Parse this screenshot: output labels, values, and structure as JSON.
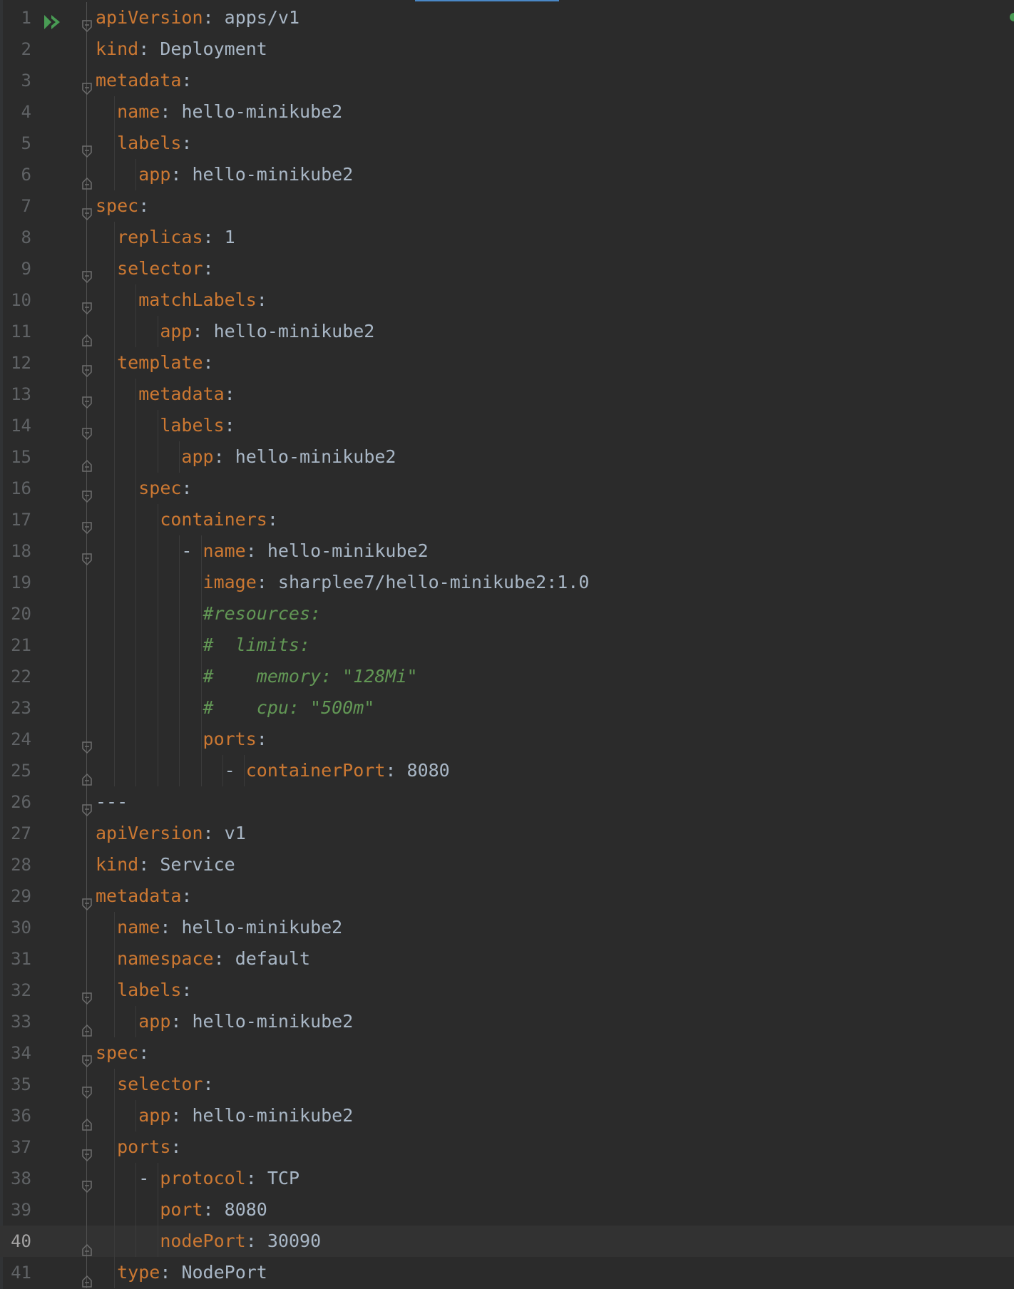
{
  "editor": {
    "language": "yaml",
    "current_line": 40,
    "colors": {
      "background": "#2b2b2b",
      "key": "#cc7832",
      "value": "#a9b7c6",
      "comment": "#629755",
      "line_number": "#606366",
      "current_line_bg": "#323232"
    },
    "lines": [
      {
        "n": "1",
        "indent": "",
        "key": "apiVersion",
        "value": "apps/v1"
      },
      {
        "n": "2",
        "indent": "",
        "key": "kind",
        "value": "Deployment"
      },
      {
        "n": "3",
        "indent": "",
        "key": "metadata",
        "value": ""
      },
      {
        "n": "4",
        "indent": "  ",
        "key": "name",
        "value": "hello-minikube2"
      },
      {
        "n": "5",
        "indent": "  ",
        "key": "labels",
        "value": ""
      },
      {
        "n": "6",
        "indent": "    ",
        "key": "app",
        "value": "hello-minikube2"
      },
      {
        "n": "7",
        "indent": "",
        "key": "spec",
        "value": ""
      },
      {
        "n": "8",
        "indent": "  ",
        "key": "replicas",
        "value": "1"
      },
      {
        "n": "9",
        "indent": "  ",
        "key": "selector",
        "value": ""
      },
      {
        "n": "10",
        "indent": "    ",
        "key": "matchLabels",
        "value": ""
      },
      {
        "n": "11",
        "indent": "      ",
        "key": "app",
        "value": "hello-minikube2"
      },
      {
        "n": "12",
        "indent": "  ",
        "key": "template",
        "value": ""
      },
      {
        "n": "13",
        "indent": "    ",
        "key": "metadata",
        "value": ""
      },
      {
        "n": "14",
        "indent": "      ",
        "key": "labels",
        "value": ""
      },
      {
        "n": "15",
        "indent": "        ",
        "key": "app",
        "value": "hello-minikube2"
      },
      {
        "n": "16",
        "indent": "    ",
        "key": "spec",
        "value": ""
      },
      {
        "n": "17",
        "indent": "      ",
        "key": "containers",
        "value": ""
      },
      {
        "n": "18",
        "indent": "        - ",
        "key": "name",
        "value": "hello-minikube2"
      },
      {
        "n": "19",
        "indent": "          ",
        "key": "image",
        "value": "sharplee7/hello-minikube2:1.0"
      },
      {
        "n": "20",
        "indent": "          ",
        "comment": "#resources:"
      },
      {
        "n": "21",
        "indent": "          ",
        "comment": "#  limits:"
      },
      {
        "n": "22",
        "indent": "          ",
        "comment": "#    memory: \"128Mi\""
      },
      {
        "n": "23",
        "indent": "          ",
        "comment": "#    cpu: \"500m\""
      },
      {
        "n": "24",
        "indent": "          ",
        "key": "ports",
        "value": ""
      },
      {
        "n": "25",
        "indent": "            - ",
        "key": "containerPort",
        "value": "8080"
      },
      {
        "n": "26",
        "indent": "",
        "plain": "---"
      },
      {
        "n": "27",
        "indent": "",
        "key": "apiVersion",
        "value": "v1"
      },
      {
        "n": "28",
        "indent": "",
        "key": "kind",
        "value": "Service"
      },
      {
        "n": "29",
        "indent": "",
        "key": "metadata",
        "value": ""
      },
      {
        "n": "30",
        "indent": "  ",
        "key": "name",
        "value": "hello-minikube2"
      },
      {
        "n": "31",
        "indent": "  ",
        "key": "namespace",
        "value": "default"
      },
      {
        "n": "32",
        "indent": "  ",
        "key": "labels",
        "value": ""
      },
      {
        "n": "33",
        "indent": "    ",
        "key": "app",
        "value": "hello-minikube2"
      },
      {
        "n": "34",
        "indent": "",
        "key": "spec",
        "value": ""
      },
      {
        "n": "35",
        "indent": "  ",
        "key": "selector",
        "value": ""
      },
      {
        "n": "36",
        "indent": "    ",
        "key": "app",
        "value": "hello-minikube2"
      },
      {
        "n": "37",
        "indent": "  ",
        "key": "ports",
        "value": ""
      },
      {
        "n": "38",
        "indent": "    - ",
        "key": "protocol",
        "value": "TCP"
      },
      {
        "n": "39",
        "indent": "      ",
        "key": "port",
        "value": "8080"
      },
      {
        "n": "40",
        "indent": "      ",
        "key": "nodePort",
        "value": "30090"
      },
      {
        "n": "41",
        "indent": "  ",
        "key": "type",
        "value": "NodePort"
      }
    ]
  }
}
